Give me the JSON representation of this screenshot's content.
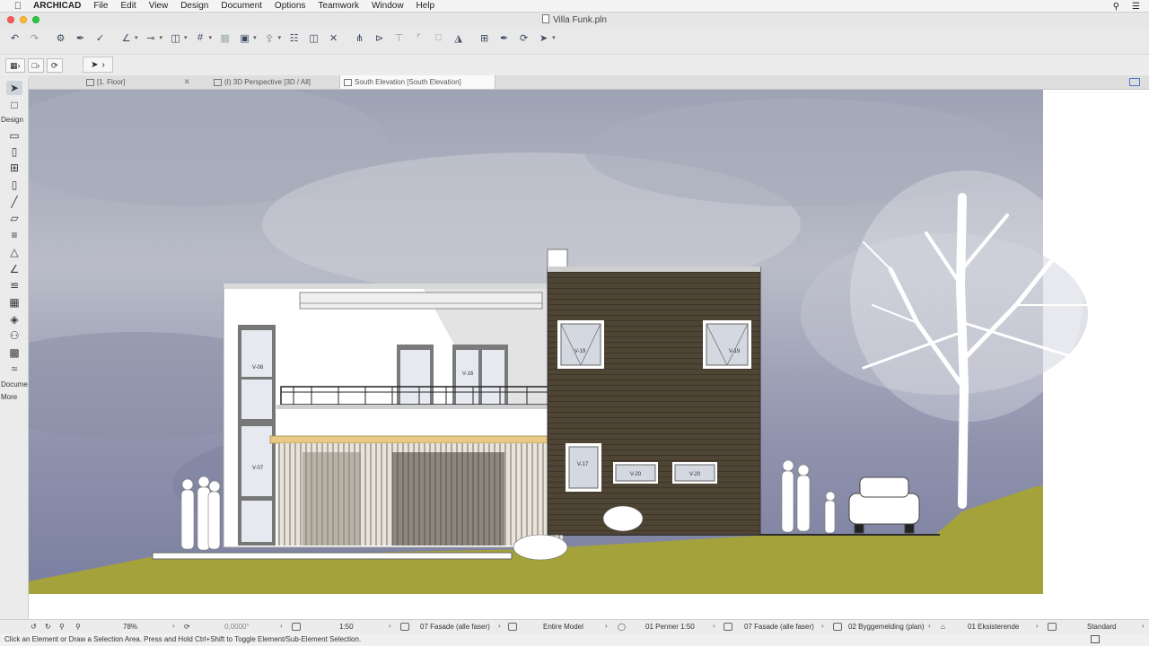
{
  "menubar": {
    "app_name": "ARCHICAD",
    "items": [
      "File",
      "Edit",
      "View",
      "Design",
      "Document",
      "Options",
      "Teamwork",
      "Window",
      "Help"
    ]
  },
  "window": {
    "title": "Villa Funk.pln"
  },
  "tabs": [
    {
      "label": "[1. Floor]"
    },
    {
      "label": "(I) 3D Perspective [3D / All]"
    },
    {
      "label": "South Elevation [South Elevation]"
    }
  ],
  "toolbox": {
    "section_design": "Design",
    "section_document": "Docume",
    "section_more": "More"
  },
  "drawing": {
    "window_labels": [
      "V-08",
      "V-07",
      "V-16",
      "V-19",
      "V-19",
      "V-17",
      "V-20",
      "V-20"
    ],
    "colors": {
      "sky": "#8d94a8",
      "ground": "#a4a23a",
      "cladding": "#4f4535",
      "wall": "#ffffff",
      "beam": "#e8c986"
    }
  },
  "statusbar": {
    "zoom": "78%",
    "angle": "0,0000°",
    "scale": "1:50",
    "layer_combo": "07 Fasade (alle faser)",
    "model_view": "Entire Model",
    "pen_set": "01 Penner 1:50",
    "model_view_option": "07 Fasade (alle faser)",
    "dimension": "02 Byggemelding (plan)",
    "renovation": "01 Eksisterende",
    "partial_structure": "Standard"
  },
  "hint": "Click an Element or Draw a Selection Area. Press and Hold Ctrl+Shift to Toggle Element/Sub-Element Selection."
}
